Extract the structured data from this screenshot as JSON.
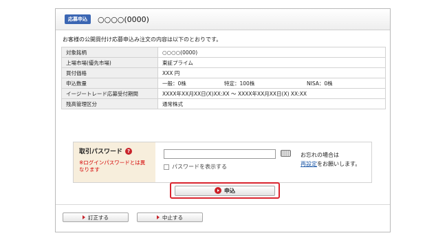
{
  "header": {
    "badge": "応募申込",
    "stock_name": "○○○○(0000)"
  },
  "intro_text": "お客様の公開買付け応募申込み注文の内容は以下のとおりです。",
  "info_rows": [
    {
      "label": "対象銘柄",
      "value": "○○○○(0000)"
    },
    {
      "label": "上場市場(優先市場)",
      "value": "東証プライム"
    },
    {
      "label": "買付価格",
      "value": "XXX 円"
    },
    {
      "label": "申込数量",
      "general": "一般：0株",
      "specific": "特定：100株",
      "nisa": "NISA：0株"
    },
    {
      "label": "イージートレード応募受付期間",
      "value": "XXXX年XX月XX日(X)XX:XX ～ XXXX年XX月XX日(X) XX:XX"
    },
    {
      "label": "残高管理区分",
      "value": "通常株式"
    }
  ],
  "password": {
    "title": "取引パスワード",
    "help_icon": "question-icon",
    "note": "※ログインパスワードとは異なります",
    "input_value": "",
    "show_password_label": "パスワードを表示する",
    "forgot_prefix": "お忘れの場合は",
    "forgot_link": "再設定",
    "forgot_suffix": "をお願いします。"
  },
  "submit_label": "申込",
  "buttons": {
    "correct": "訂正する",
    "cancel": "中止する"
  },
  "colors": {
    "badge": "#3b66b3",
    "accent_red": "#d9232d",
    "label_bg": "#f7eedc"
  }
}
